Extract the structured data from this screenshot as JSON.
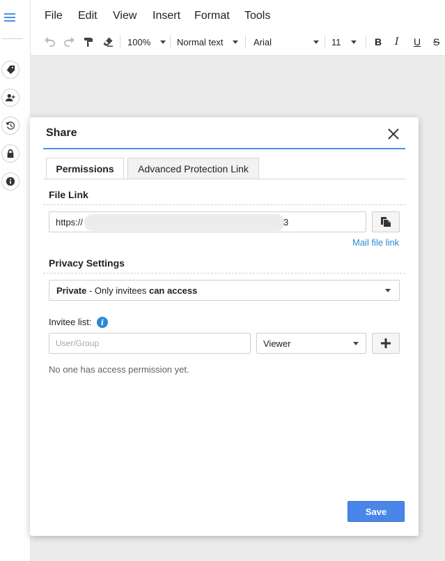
{
  "menubar": {
    "items": [
      "File",
      "Edit",
      "View",
      "Insert",
      "Format",
      "Tools"
    ]
  },
  "toolbar": {
    "zoom": "100%",
    "style": "Normal text",
    "font": "Arial",
    "font_size": "11",
    "bold": "B",
    "italic": "I",
    "underline": "U",
    "strike": "S"
  },
  "rail": {
    "icons": [
      "menu-icon",
      "tag-icon",
      "add-user-icon",
      "history-icon",
      "lock-icon",
      "info-icon"
    ]
  },
  "dialog": {
    "title": "Share",
    "tabs": [
      "Permissions",
      "Advanced Protection Link"
    ],
    "active_tab": "Permissions",
    "file_link_label": "File Link",
    "file_link_prefix": "https://",
    "file_link_suffix": "3",
    "mail_link": "Mail file link",
    "privacy_label": "Privacy Settings",
    "privacy": {
      "strong": "Private",
      "middle": " - Only invitees ",
      "strong_end": "can access"
    },
    "invitee_label": "Invitee list:",
    "user_placeholder": "User/Group",
    "role": "Viewer",
    "empty_note": "No one has access permission yet.",
    "save": "Save"
  },
  "colors": {
    "accent": "#4a86e8",
    "link": "#2a8ad4",
    "canvas": "#ececec"
  }
}
